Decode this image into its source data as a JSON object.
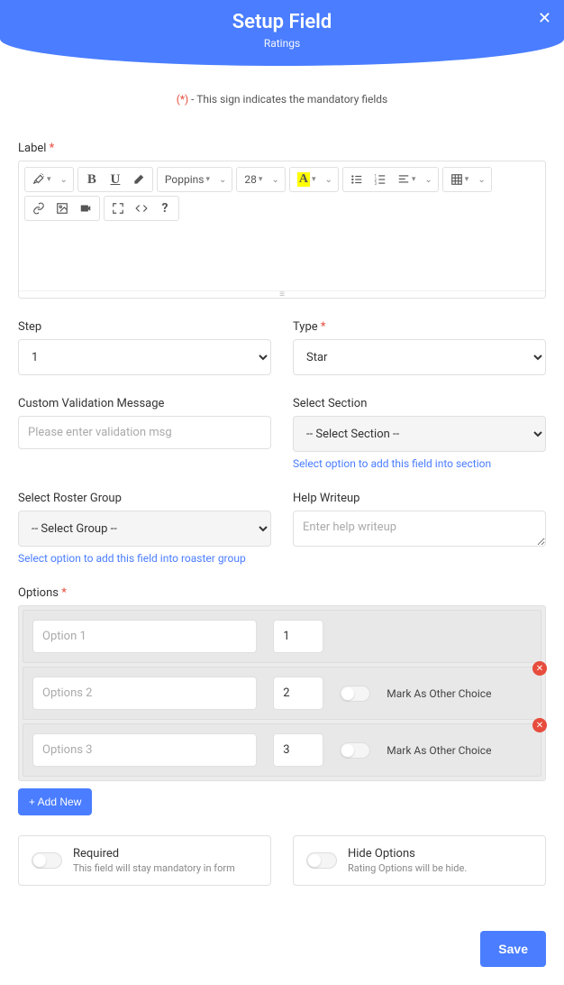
{
  "header": {
    "title": "Setup Field",
    "subtitle": "Ratings",
    "close": "✕"
  },
  "mandatory_note": {
    "star": "(*)",
    "text": " - This sign indicates the mandatory fields"
  },
  "labels": {
    "label": "Label",
    "step": "Step",
    "type": "Type",
    "custom_validation": "Custom Validation Message",
    "select_section": "Select Section",
    "select_roster": "Select Roster Group",
    "help_writeup": "Help Writeup",
    "options": "Options"
  },
  "toolbar": {
    "font_family": "Poppins",
    "font_size": "28"
  },
  "form": {
    "step_value": "1",
    "type_value": "Star",
    "validation_placeholder": "Please enter validation msg",
    "section_value": "-- Select Section --",
    "section_hint": "Select option to add this field into section",
    "roster_value": "-- Select Group --",
    "roster_hint": "Select option to add this field into roaster group",
    "help_placeholder": "Enter help writeup"
  },
  "options": [
    {
      "name": "Option 1",
      "val": "1",
      "show_other": false,
      "removable": false
    },
    {
      "name": "Options 2",
      "val": "2",
      "show_other": true,
      "removable": true
    },
    {
      "name": "Options 3",
      "val": "3",
      "show_other": true,
      "removable": true
    }
  ],
  "other_label": "Mark As Other Choice",
  "add_new": "+ Add New",
  "switches": {
    "required": {
      "title": "Required",
      "desc": "This field will stay mandatory in form"
    },
    "hide": {
      "title": "Hide Options",
      "desc": "Rating Options will be hide."
    }
  },
  "save": "Save"
}
